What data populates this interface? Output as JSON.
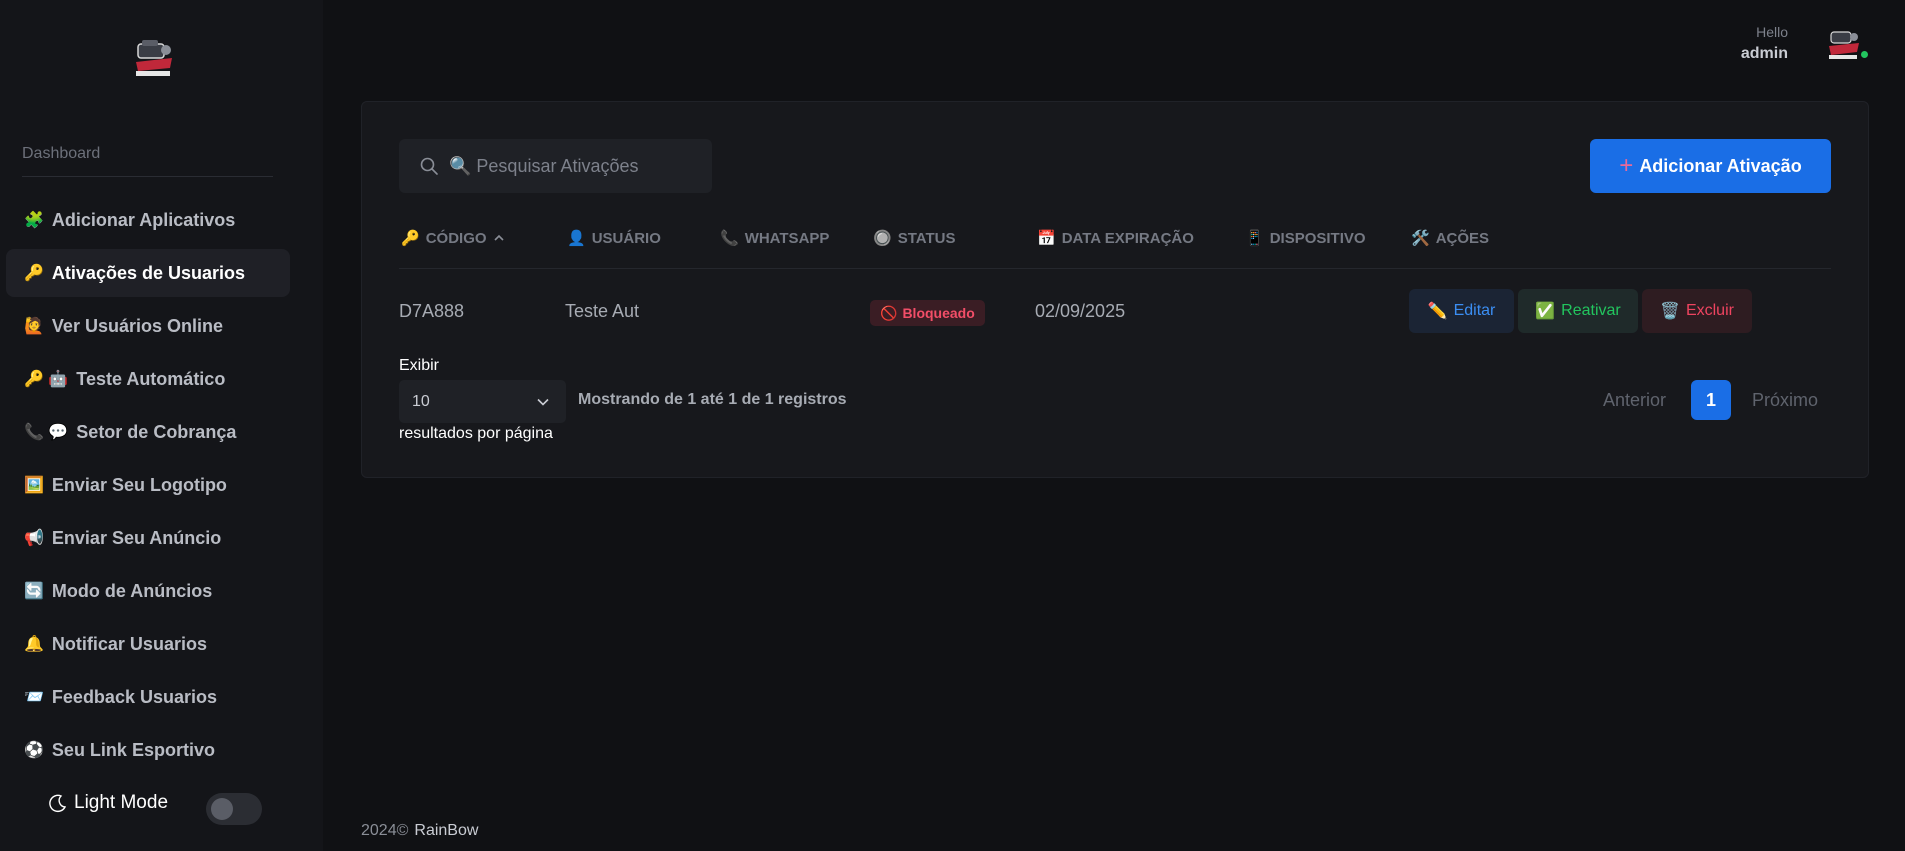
{
  "sidebar": {
    "section_label": "Dashboard",
    "items": [
      {
        "icon": "🧩",
        "label": "Adicionar Aplicativos",
        "active": false
      },
      {
        "icon": "🔑",
        "label": "Ativações de Usuarios",
        "active": true
      },
      {
        "icon": "🙋",
        "label": "Ver Usuários Online",
        "active": false
      },
      {
        "icon": "🔑 🤖",
        "label": "Teste Automático",
        "active": false
      },
      {
        "icon": "📞 💬",
        "label": "Setor de Cobrança",
        "active": false
      },
      {
        "icon": "🖼️",
        "label": "Enviar Seu Logotipo",
        "active": false
      },
      {
        "icon": "📢",
        "label": "Enviar Seu Anúncio",
        "active": false
      },
      {
        "icon": "🔄",
        "label": "Modo de Anúncios",
        "active": false
      },
      {
        "icon": "🔔",
        "label": "Notificar Usuarios",
        "active": false
      },
      {
        "icon": "📨",
        "label": "Feedback Usuarios",
        "active": false
      },
      {
        "icon": "⚽",
        "label": "Seu Link Esportivo",
        "active": false
      }
    ],
    "theme_label": "Light Mode"
  },
  "topbar": {
    "greeting": "Hello",
    "username": "admin"
  },
  "toolbar": {
    "search_placeholder": "🔍 Pesquisar Ativações",
    "add_button": "Adicionar Ativação"
  },
  "table": {
    "headers": [
      {
        "icon": "🔑",
        "label": "CÓDIGO",
        "sorted": "asc"
      },
      {
        "icon": "👤",
        "label": "USUÁRIO"
      },
      {
        "icon": "📞",
        "label": "WHATSAPP"
      },
      {
        "icon": "🔘",
        "label": "STATUS"
      },
      {
        "icon": "📅",
        "label": "DATA EXPIRAÇÃO"
      },
      {
        "icon": "📱",
        "label": "DISPOSITIVO"
      },
      {
        "icon": "🛠️",
        "label": "AÇÕES"
      }
    ],
    "rows": [
      {
        "codigo": "D7A888",
        "usuario": "Teste Aut",
        "whatsapp": "",
        "status": "Bloqueado",
        "status_icon": "🚫",
        "data_expiracao": "02/09/2025",
        "dispositivo": "",
        "actions": {
          "edit": {
            "icon": "✏️",
            "label": "Editar"
          },
          "reactivate": {
            "icon": "✅",
            "label": "Reativar"
          },
          "delete": {
            "icon": "🗑️",
            "label": "Excluir"
          }
        }
      }
    ]
  },
  "pagination": {
    "show_label": "Exibir",
    "page_size": "10",
    "info": "Mostrando de 1 até 1 de 1 registros",
    "per_page_label": "resultados por página",
    "prev": "Anterior",
    "current_page": "1",
    "next": "Próximo"
  },
  "footer": {
    "year": "2024©",
    "brand": "RainBow"
  },
  "colors": {
    "background": "#101114",
    "sidebar": "#141519",
    "card": "#17181c",
    "primary": "#1a6ee6",
    "danger": "#ef4460",
    "success": "#22c55e"
  }
}
